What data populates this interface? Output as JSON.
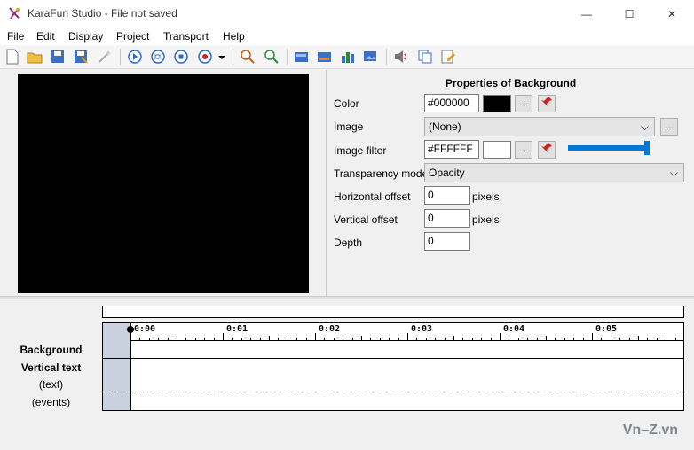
{
  "window": {
    "title": "KaraFun Studio - File not saved",
    "minimize": "—",
    "maximize": "☐",
    "close": "✕"
  },
  "menu": [
    "File",
    "Edit",
    "Display",
    "Project",
    "Transport",
    "Help"
  ],
  "toolbar_icons": [
    "new-file-icon",
    "open-folder-icon",
    "save-icon",
    "save-as-icon",
    "wizard-icon",
    "play-icon",
    "play-loop-icon",
    "stop-icon",
    "record-icon",
    "dropdown-icon",
    "zoom-in-icon",
    "zoom-out-icon",
    "add-block-icon",
    "add-block-2-icon",
    "add-chart-icon",
    "add-image-icon",
    "volume-icon",
    "copy-icon",
    "edit-icon"
  ],
  "properties": {
    "title": "Properties of Background",
    "color": {
      "label": "Color",
      "value": "#000000",
      "swatch": "#000000",
      "more": "..."
    },
    "image": {
      "label": "Image",
      "value": "(None)",
      "more": "..."
    },
    "image_filter": {
      "label": "Image filter",
      "value": "#FFFFFF",
      "swatch": "#FFFFFF",
      "more": "..."
    },
    "transparency_mode": {
      "label": "Transparency mode",
      "value": "Opacity"
    },
    "horizontal_offset": {
      "label": "Horizontal offset",
      "value": "0",
      "unit": "pixels"
    },
    "vertical_offset": {
      "label": "Vertical offset",
      "value": "0",
      "unit": "pixels"
    },
    "depth": {
      "label": "Depth",
      "value": "0"
    },
    "slider_level": 1.0
  },
  "timeline": {
    "ticks": [
      "0:00",
      "0:01",
      "0:02",
      "0:03",
      "0:04",
      "0:05"
    ],
    "tracks": [
      {
        "label": "Background",
        "bold": true
      },
      {
        "label": "Vertical text",
        "bold": true
      },
      {
        "label": "(text)",
        "bold": false
      },
      {
        "label": "(events)",
        "bold": false
      }
    ]
  },
  "watermark": "Vn–Z.vn",
  "colors": {
    "preview_bg": "#000000",
    "accent": "#0078d7",
    "gutter": "#c9d1df"
  }
}
